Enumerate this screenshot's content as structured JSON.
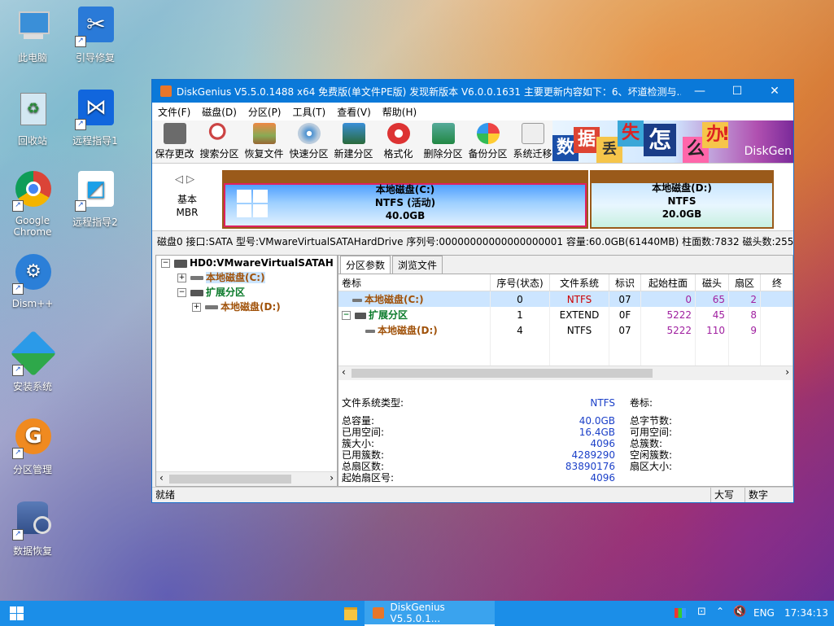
{
  "desktop_icons": [
    {
      "label": "此电脑",
      "icon": "computer-icon"
    },
    {
      "label": "引导修复",
      "icon": "wrench-icon"
    },
    {
      "label": "回收站",
      "icon": "recycle-bin-icon"
    },
    {
      "label": "远程指导1",
      "icon": "remote-icon"
    },
    {
      "label": "Google\nChrome",
      "icon": "chrome-icon"
    },
    {
      "label": "远程指导2",
      "icon": "remote-icon"
    },
    {
      "label": "Dism++",
      "icon": "gear-icon"
    },
    {
      "label": "安装系统",
      "icon": "install-icon"
    },
    {
      "label": "分区管理",
      "icon": "partition-icon"
    },
    {
      "label": "数据恢复",
      "icon": "data-recovery-icon"
    }
  ],
  "window": {
    "title": "DiskGenius V5.5.0.1488 x64 免费版(单文件PE版)   发现新版本 V6.0.0.1631   主要更新内容如下：6、坏道检测与..."
  },
  "menu": [
    "文件(F)",
    "磁盘(D)",
    "分区(P)",
    "工具(T)",
    "查看(V)",
    "帮助(H)"
  ],
  "toolbar": [
    "保存更改",
    "搜索分区",
    "恢复文件",
    "快速分区",
    "新建分区",
    "格式化",
    "删除分区",
    "备份分区",
    "系统迁移"
  ],
  "banner": {
    "chars": [
      "数",
      "据",
      "丢",
      "失",
      "怎",
      "么",
      "办",
      "!"
    ],
    "brand": "DiskGen"
  },
  "diskmap": {
    "disk_type": "基本",
    "disk_style": "MBR",
    "c": {
      "name": "本地磁盘(C:)",
      "fs": "NTFS (活动)",
      "size": "40.0GB"
    },
    "d": {
      "name": "本地磁盘(D:)",
      "fs": "NTFS",
      "size": "20.0GB"
    }
  },
  "infoline": "磁盘0 接口:SATA  型号:VMwareVirtualSATAHardDrive  序列号:00000000000000000001  容量:60.0GB(61440MB)  柱面数:7832  磁头数:255",
  "tree": {
    "root": "HD0:VMwareVirtualSATAH",
    "c": "本地磁盘(C:)",
    "ext": "扩展分区",
    "d": "本地磁盘(D:)"
  },
  "tabs": [
    "分区参数",
    "浏览文件"
  ],
  "table": {
    "headers": [
      "卷标",
      "序号(状态)",
      "文件系统",
      "标识",
      "起始柱面",
      "磁头",
      "扇区",
      "终"
    ],
    "rows": [
      [
        "本地磁盘(C:)",
        "0",
        "NTFS",
        "07",
        "0",
        "65",
        "2"
      ],
      [
        "扩展分区",
        "1",
        "EXTEND",
        "0F",
        "5222",
        "45",
        "8"
      ],
      [
        "本地磁盘(D:)",
        "4",
        "NTFS",
        "07",
        "5222",
        "110",
        "9"
      ]
    ]
  },
  "info": {
    "fs_type_label": "文件系统类型:",
    "fs_type": "NTFS",
    "vol_label": "卷标:",
    "left_labels": [
      "总容量:",
      "已用空间:",
      "簇大小:",
      "已用簇数:",
      "总扇区数:",
      "起始扇区号:"
    ],
    "left_values": [
      "40.0GB",
      "16.4GB",
      "4096",
      "4289290",
      "83890176",
      "4096"
    ],
    "right_labels": [
      "总字节数:",
      "可用空间:",
      "总簇数:",
      "空闲簇数:",
      "扇区大小:"
    ]
  },
  "status": {
    "left": "就绪",
    "caps": "大写",
    "num": "数字"
  },
  "taskbar": {
    "task_label": "DiskGenius V5.5.0.1...",
    "lang": "ENG",
    "time": "17:34:13"
  }
}
